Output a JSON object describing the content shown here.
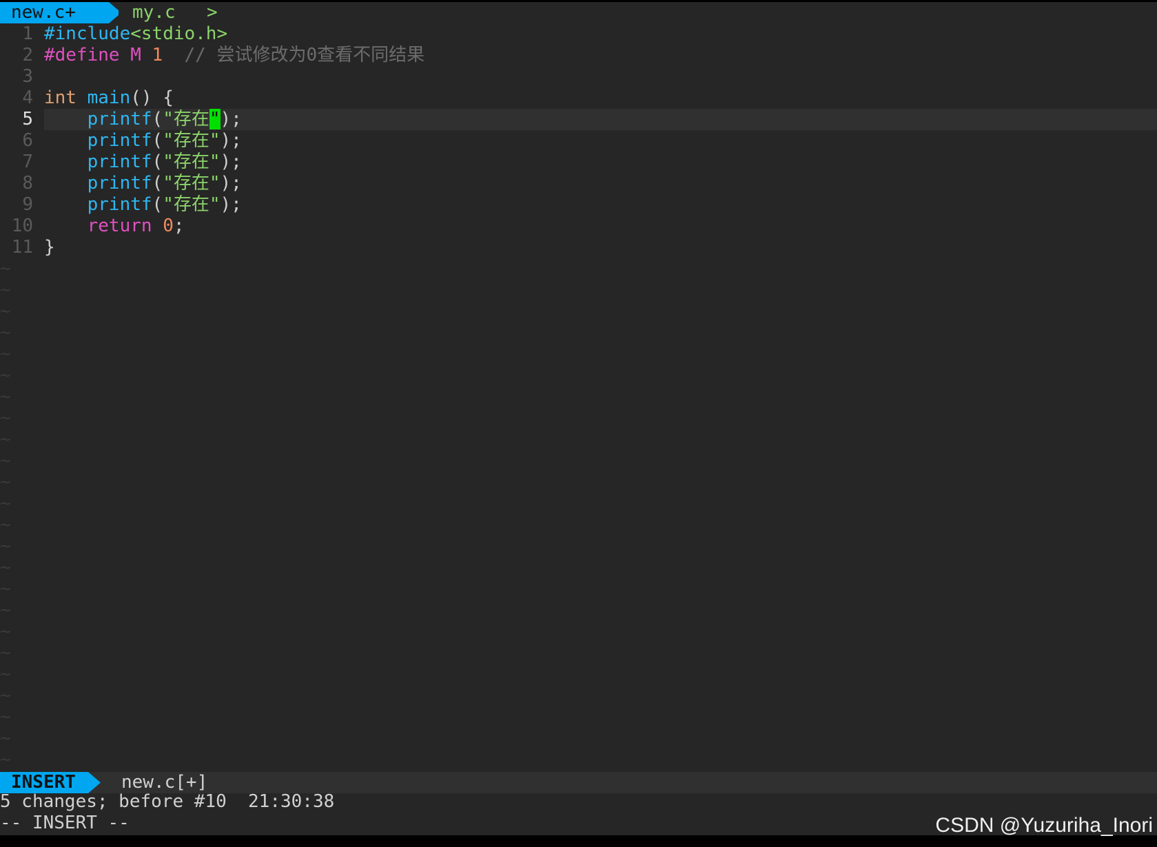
{
  "tabline": {
    "active_tab": "new.c+",
    "inactive_tab": "my.c",
    "separator": ">"
  },
  "editor": {
    "lines": [
      {
        "num": "1",
        "tokens": [
          {
            "t": "#include",
            "c": "kw-inc"
          },
          {
            "t": "<stdio.h>",
            "c": "hdr"
          }
        ]
      },
      {
        "num": "2",
        "tokens": [
          {
            "t": "#define",
            "c": "kw-pre"
          },
          {
            "t": " M ",
            "c": "kw-pre"
          },
          {
            "t": "1",
            "c": "num"
          },
          {
            "t": "  // 尝试修改为0查看不同结果",
            "c": "cmt"
          }
        ]
      },
      {
        "num": "3",
        "tokens": []
      },
      {
        "num": "4",
        "tokens": [
          {
            "t": "int",
            "c": "typ"
          },
          {
            "t": " ",
            "c": "plain"
          },
          {
            "t": "main",
            "c": "fn"
          },
          {
            "t": "() {",
            "c": "plain"
          }
        ]
      },
      {
        "num": "5",
        "tokens": [
          {
            "t": "    ",
            "c": "plain"
          },
          {
            "t": "printf",
            "c": "fn"
          },
          {
            "t": "(",
            "c": "plain"
          },
          {
            "t": "\"存在",
            "c": "str"
          },
          {
            "t": "\"",
            "c": "cursor"
          },
          {
            "t": ");",
            "c": "plain"
          }
        ],
        "current": true
      },
      {
        "num": "6",
        "tokens": [
          {
            "t": "    ",
            "c": "plain"
          },
          {
            "t": "printf",
            "c": "fn"
          },
          {
            "t": "(",
            "c": "plain"
          },
          {
            "t": "\"存在\"",
            "c": "str"
          },
          {
            "t": ");",
            "c": "plain"
          }
        ]
      },
      {
        "num": "7",
        "tokens": [
          {
            "t": "    ",
            "c": "plain"
          },
          {
            "t": "printf",
            "c": "fn"
          },
          {
            "t": "(",
            "c": "plain"
          },
          {
            "t": "\"存在\"",
            "c": "str"
          },
          {
            "t": ");",
            "c": "plain"
          }
        ]
      },
      {
        "num": "8",
        "tokens": [
          {
            "t": "    ",
            "c": "plain"
          },
          {
            "t": "printf",
            "c": "fn"
          },
          {
            "t": "(",
            "c": "plain"
          },
          {
            "t": "\"存在\"",
            "c": "str"
          },
          {
            "t": ");",
            "c": "plain"
          }
        ]
      },
      {
        "num": "9",
        "tokens": [
          {
            "t": "    ",
            "c": "plain"
          },
          {
            "t": "printf",
            "c": "fn"
          },
          {
            "t": "(",
            "c": "plain"
          },
          {
            "t": "\"存在\"",
            "c": "str"
          },
          {
            "t": ");",
            "c": "plain"
          }
        ]
      },
      {
        "num": "10",
        "tokens": [
          {
            "t": "    ",
            "c": "plain"
          },
          {
            "t": "return",
            "c": "ret"
          },
          {
            "t": " ",
            "c": "plain"
          },
          {
            "t": "0",
            "c": "num"
          },
          {
            "t": ";",
            "c": "plain"
          }
        ]
      },
      {
        "num": "11",
        "tokens": [
          {
            "t": "}",
            "c": "plain"
          }
        ]
      }
    ],
    "tilde": "~",
    "tilde_count": 24
  },
  "statusline": {
    "mode": "INSERT",
    "filename": "new.c[+]"
  },
  "messages": {
    "line1": "5 changes; before #10  21:30:38",
    "line2": "-- INSERT --"
  },
  "watermark": "CSDN @Yuzuriha_Inori",
  "colors": {
    "background": "#262626",
    "accent": "#00a6ef",
    "cursor": "#00e000",
    "string": "#8bd36a",
    "function": "#2fb7f2",
    "keyword": "#e050c0",
    "number": "#f08a5d",
    "comment": "#6c6c6c"
  }
}
